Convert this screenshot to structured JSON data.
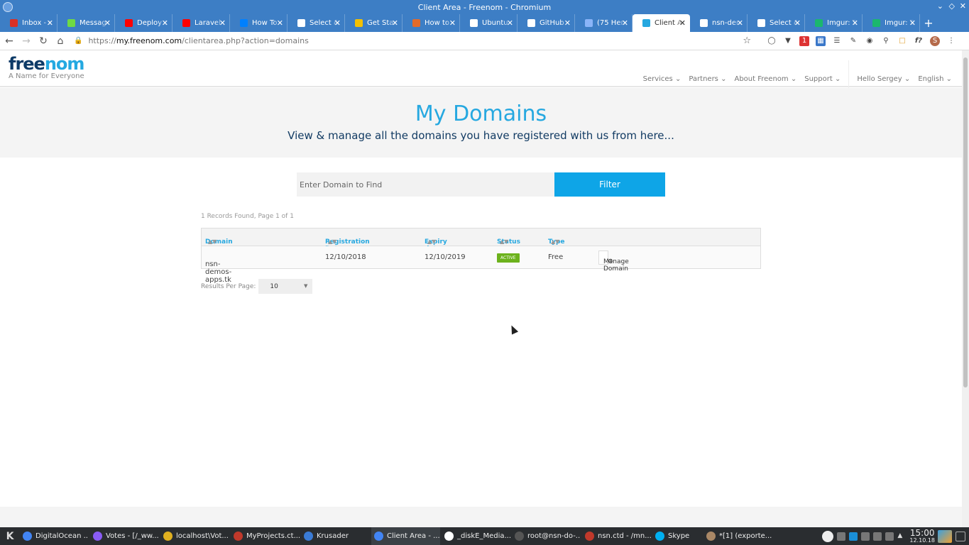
{
  "window": {
    "title": "Client Area - Freenom - Chromium"
  },
  "tabs": [
    {
      "label": "Inbox - r",
      "icon": "gmail-icon",
      "color": "#d93025"
    },
    {
      "label": "Messag",
      "icon": "upwork-icon",
      "color": "#6fda44"
    },
    {
      "label": "Deploy L",
      "icon": "youtube-icon",
      "color": "#ff0000"
    },
    {
      "label": "Laravel 5",
      "icon": "youtube-icon",
      "color": "#ff0000"
    },
    {
      "label": "How To",
      "icon": "digitalocean-icon",
      "color": "#0080ff"
    },
    {
      "label": "Select &",
      "icon": "page-icon",
      "color": "#ffffff"
    },
    {
      "label": "Get Star",
      "icon": "gitbook-icon",
      "color": "#f4c000"
    },
    {
      "label": "How to",
      "icon": "askubuntu-icon",
      "color": "#e26b2a"
    },
    {
      "label": "Ubuntu",
      "icon": "r-icon",
      "color": "#ffffff"
    },
    {
      "label": "GitHub",
      "icon": "github-icon",
      "color": "#ffffff"
    },
    {
      "label": "(75 Непр",
      "icon": "mail-icon",
      "color": "#8ab4f8"
    },
    {
      "label": "Client Ar",
      "icon": "freenom-icon",
      "color": "#26a8e0",
      "active": true
    },
    {
      "label": "nsn-den",
      "icon": "page-icon",
      "color": "#ffffff"
    },
    {
      "label": "Select &",
      "icon": "page-icon",
      "color": "#ffffff"
    },
    {
      "label": "Imgur: T",
      "icon": "imgur-icon",
      "color": "#1bb76e"
    },
    {
      "label": "Imgur: T",
      "icon": "imgur-icon",
      "color": "#1bb76e"
    }
  ],
  "address": {
    "protocol": "https://",
    "host": "my.freenom.com",
    "path": "/clientarea.php?action=domains"
  },
  "site": {
    "logo_text_1": "free",
    "logo_text_2": "nom",
    "tagline": "A Name for Everyone",
    "nav": [
      "Services",
      "Partners",
      "About Freenom",
      "Support"
    ],
    "user": "Hello Sergey",
    "language": "English"
  },
  "hero": {
    "title": "My Domains",
    "subtitle": "View & manage all the domains you have registered with us from here..."
  },
  "search": {
    "placeholder": "Enter Domain to Find",
    "button": "Filter"
  },
  "records_text": "1 Records Found, Page 1 of 1",
  "table": {
    "headers": [
      "Domain",
      "Registration Date",
      "Expiry date",
      "Status",
      "Type"
    ],
    "rows": [
      {
        "domain": "nsn-demos-apps.tk",
        "registration": "12/10/2018",
        "expiry": "12/10/2019",
        "status": "ACTIVE",
        "type": "Free",
        "action": "Manage Domain"
      }
    ]
  },
  "per_page": {
    "label": "Results Per Page:",
    "value": "10"
  },
  "taskbar": {
    "items": [
      {
        "label": "DigitalOcean ...",
        "color": "#4285f4"
      },
      {
        "label": "Votes - [/_ww...",
        "color": "#8a5cf5"
      },
      {
        "label": "localhost\\Vot...",
        "color": "#e0b020"
      },
      {
        "label": "MyProjects.ct...",
        "color": "#c0392b"
      },
      {
        "label": "Krusader",
        "color": "#3a7bd5"
      },
      {
        "label": "Client Area - ...",
        "color": "#4285f4",
        "active": true
      },
      {
        "label": "_diskE_Media...",
        "color": "#ffffff"
      },
      {
        "label": "root@nsn-do-...",
        "color": "#555555"
      },
      {
        "label": "nsn.ctd - /mn...",
        "color": "#c0392b"
      },
      {
        "label": "Skype",
        "color": "#00aff0"
      },
      {
        "label": "*[1] (exporte...",
        "color": "#aa8866"
      }
    ],
    "time": "15:00",
    "date": "12.10.18"
  }
}
